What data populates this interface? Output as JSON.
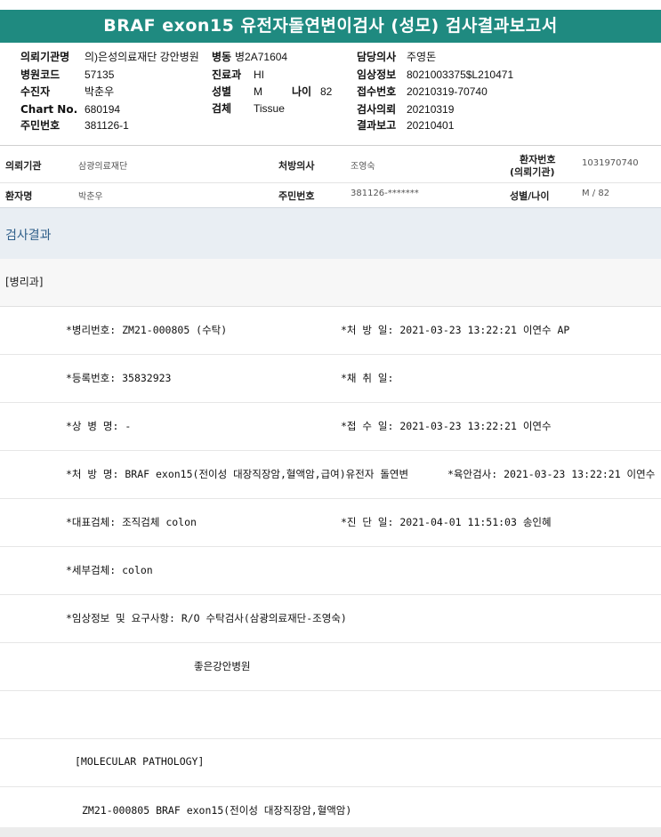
{
  "report": {
    "title": "BRAF exon15 유전자돌연변이검사 (성모) 검사결과보고서"
  },
  "header": {
    "institution_label": "의뢰기관명",
    "institution_value": "의)은성의료재단 강안병원",
    "ward_label": "병동",
    "ward_value": "병2A71604",
    "doctor_label": "담당의사",
    "doctor_value": "주영돈",
    "hospital_code_label": "병원코드",
    "hospital_code_value": "57135",
    "dept_label": "진료과",
    "dept_value": "HI",
    "clinical_label": "임상정보",
    "clinical_value": "8021003375$L210471",
    "patient_label": "수진자",
    "patient_value": "박춘우",
    "sex_label": "성별",
    "sex_value": "M",
    "age_label": "나이",
    "age_value": "82",
    "receipt_label": "접수번호",
    "receipt_value": "20210319-70740",
    "chart_label": "Chart No.",
    "chart_value": "680194",
    "specimen_label": "검체",
    "specimen_value": "Tissue",
    "request_label": "검사의뢰",
    "request_value": "20210319",
    "resident_label": "주민번호",
    "resident_value": "381126-1",
    "report_date_label": "결과보고",
    "report_date_value": "20210401"
  },
  "info": {
    "institution_label": "의뢰기관",
    "institution_value": "삼광의료재단",
    "prescriber_label": "처방의사",
    "prescriber_value": "조영숙",
    "patient_no_label_1": "환자번호",
    "patient_no_label_2": "(의뢰기관)",
    "patient_no_value": "1031970740",
    "name_label": "환자명",
    "name_value": "박춘우",
    "resident_label": "주민번호",
    "resident_value": "381126-*******",
    "sexage_label": "성별/나이",
    "sexage_value": "M / 82"
  },
  "result": {
    "section_title": "검사결과",
    "dept": "[병리과]",
    "path_no": "*병리번호: ZM21-000805 (수탁)",
    "order_date": "*처 방 일: 2021-03-23 13:22:21  이연수 AP",
    "reg_no": "*등록번호: 35832923",
    "collect_date": "*채 취 일:",
    "diagnosis": "*상 병 명: -",
    "receive_date": "*접 수 일: 2021-03-23 13:22:21  이연수",
    "order_name": "*처 방 명: BRAF exon15(전이성 대장직장암,혈액암,급여)유전자 돌연변",
    "gross_exam": "*육안검사: 2021-03-23 13:22:21  이연수",
    "main_specimen": "*대표검체: 조직검체 colon",
    "diag_date": "*진 단 일: 2021-04-01 11:51:03  송인혜",
    "sub_specimen": "*세부검체: colon",
    "clinical_request": "*임상정보 및 요구사항: R/O 수탁검사(삼광의료재단-조영숙)",
    "hospital_name": "좋은강안병원",
    "molecular_header": "[MOLECULAR PATHOLOGY]",
    "molecular_line": "ZM21-000805     BRAF exon15(전이성 대장직장암,혈액암)"
  }
}
